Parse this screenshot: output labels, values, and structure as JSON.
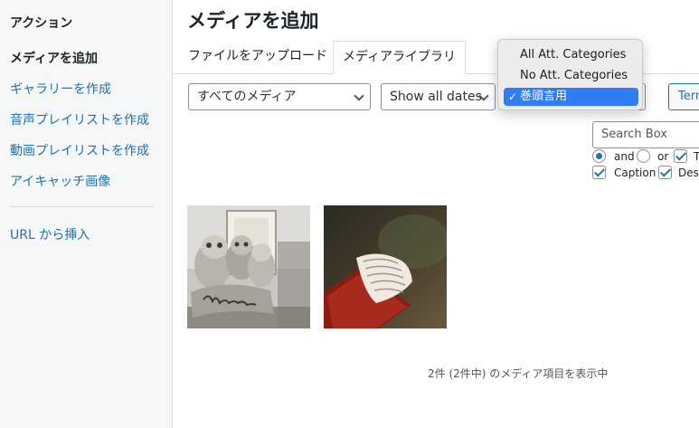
{
  "sidebar": {
    "heading": "アクション",
    "items": [
      {
        "label": "メディアを追加"
      },
      {
        "label": "ギャラリーを作成"
      },
      {
        "label": "音声プレイリストを作成"
      },
      {
        "label": "動画プレイリストを作成"
      },
      {
        "label": "アイキャッチ画像"
      }
    ],
    "insert_url": "URL から挿入"
  },
  "main": {
    "title": "メディアを追加",
    "tabs": [
      {
        "label": "ファイルをアップロード"
      },
      {
        "label": "メディアライブラリ"
      }
    ]
  },
  "filters": {
    "media_type": "すべてのメディア",
    "dates": "Show all dates",
    "terms_button": "Terms",
    "search_placeholder": "Search Box",
    "and_label": "and",
    "or_label": "or",
    "title_label": "T",
    "caption_label": "Caption",
    "description_label": "Des"
  },
  "category_dropdown": {
    "options": [
      {
        "label": "All Att. Categories"
      },
      {
        "label": "No Att. Categories"
      },
      {
        "label": "巻頭言用",
        "selected": true
      }
    ],
    "check_mark": "✓"
  },
  "media_count": "2件 (2件中) のメディア項目を表示中",
  "colors": {
    "link": "#2271b1",
    "sidebar_bg": "#f6f7f7",
    "selected_option": "#2e7cf6"
  }
}
